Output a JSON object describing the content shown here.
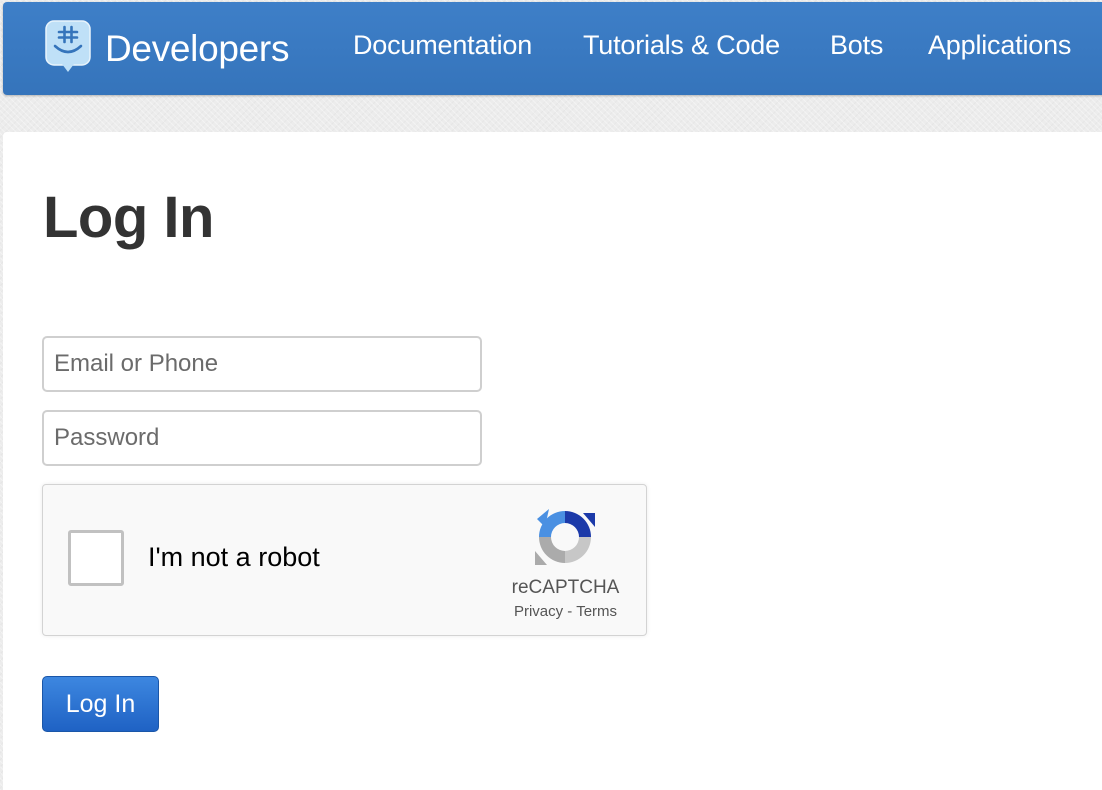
{
  "header": {
    "brand": "Developers",
    "nav": [
      {
        "label": "Documentation"
      },
      {
        "label": "Tutorials & Code"
      },
      {
        "label": "Bots"
      },
      {
        "label": "Applications"
      }
    ]
  },
  "main": {
    "title": "Log In",
    "email_placeholder": "Email or Phone",
    "password_placeholder": "Password",
    "recaptcha": {
      "label": "I'm not a robot",
      "brand": "reCAPTCHA",
      "privacy": "Privacy",
      "separator": "-",
      "terms": "Terms"
    },
    "login_button": "Log In"
  },
  "colors": {
    "navbar": "#3b7bc4",
    "button": "#2a70d4",
    "title": "#333333"
  }
}
